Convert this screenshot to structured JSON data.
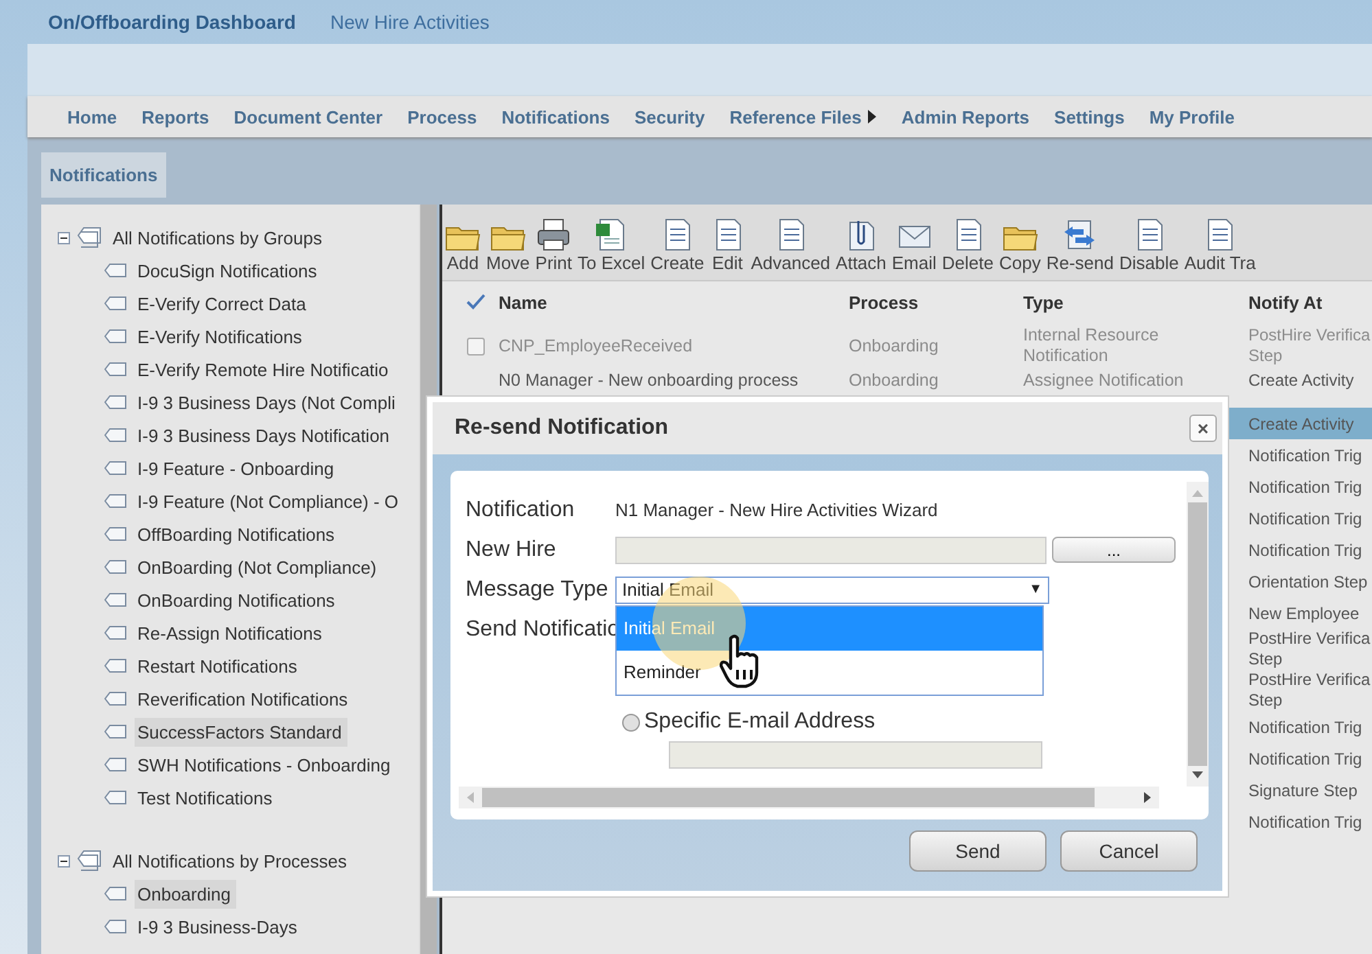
{
  "header": {
    "title": "On/Offboarding Dashboard",
    "link": "New Hire Activities"
  },
  "nav": [
    {
      "label": "Home",
      "has_submenu": false
    },
    {
      "label": "Reports",
      "has_submenu": false
    },
    {
      "label": "Document Center",
      "has_submenu": false
    },
    {
      "label": "Process",
      "has_submenu": false
    },
    {
      "label": "Notifications",
      "has_submenu": false
    },
    {
      "label": "Security",
      "has_submenu": false
    },
    {
      "label": "Reference Files",
      "has_submenu": true
    },
    {
      "label": "Admin Reports",
      "has_submenu": false
    },
    {
      "label": "Settings",
      "has_submenu": false
    },
    {
      "label": "My Profile",
      "has_submenu": false
    }
  ],
  "tabs": [
    {
      "label": "Notifications",
      "selected": true
    }
  ],
  "tree": [
    {
      "label": "All Notifications by Groups",
      "expanded": true,
      "children": [
        {
          "label": "DocuSign Notifications",
          "selected": false
        },
        {
          "label": "E-Verify Correct Data",
          "selected": false
        },
        {
          "label": "E-Verify Notifications",
          "selected": false
        },
        {
          "label": "E-Verify Remote Hire Notificatio",
          "selected": false
        },
        {
          "label": "I-9 3 Business Days (Not Compli",
          "selected": false
        },
        {
          "label": "I-9 3 Business Days Notification",
          "selected": false
        },
        {
          "label": "I-9 Feature - Onboarding",
          "selected": false
        },
        {
          "label": "I-9 Feature (Not Compliance) - O",
          "selected": false
        },
        {
          "label": "OffBoarding Notifications",
          "selected": false
        },
        {
          "label": "OnBoarding (Not Compliance)",
          "selected": false
        },
        {
          "label": "OnBoarding Notifications",
          "selected": false
        },
        {
          "label": "Re-Assign Notifications",
          "selected": false
        },
        {
          "label": "Restart Notifications",
          "selected": false
        },
        {
          "label": "Reverification Notifications",
          "selected": false
        },
        {
          "label": "SuccessFactors Standard",
          "selected": true
        },
        {
          "label": "SWH Notifications - Onboarding",
          "selected": false
        },
        {
          "label": "Test Notifications",
          "selected": false
        }
      ]
    },
    {
      "label": "All Notifications by Processes",
      "expanded": true,
      "children": [
        {
          "label": "Onboarding",
          "selected": true
        },
        {
          "label": "I-9 3 Business-Days",
          "selected": false
        }
      ]
    }
  ],
  "toolbar": [
    "Add",
    "Move",
    "Print",
    "To Excel",
    "Create",
    "Edit",
    "Advanced",
    "Attach",
    "Email",
    "Delete",
    "Copy",
    "Re-send",
    "Disable",
    "Audit Tra"
  ],
  "table": {
    "columns": [
      "Name",
      "Process",
      "Type",
      "Notify At"
    ],
    "rows": [
      {
        "name": "CNP_EmployeeReceived",
        "process": "Onboarding",
        "type": "Internal Resource Notification",
        "notify_at": "PostHire Verifica Step",
        "checked": false,
        "disabled": true,
        "selected": false
      },
      {
        "name": "N0 Manager - New onboarding process",
        "process": "Onboarding",
        "type": "Assignee Notification",
        "notify_at": "Create Activity",
        "disabled": false,
        "selected": false
      },
      {
        "notify_at": "Create Activity",
        "disabled": false,
        "selected": true
      },
      {
        "notify_at": "Notification Trig",
        "disabled": false,
        "selected": false
      },
      {
        "notify_at": "Notification Trig",
        "disabled": false,
        "selected": false
      },
      {
        "notify_at": "Notification Trig",
        "disabled": false,
        "selected": false
      },
      {
        "notify_at": "Notification Trig",
        "disabled": false,
        "selected": false
      },
      {
        "notify_at": "Orientation Step",
        "disabled": false,
        "selected": false
      },
      {
        "notify_at": "New Employee",
        "disabled": false,
        "selected": false
      },
      {
        "notify_at": "PostHire Verifica Step",
        "disabled": false,
        "selected": false
      },
      {
        "notify_at": "PostHire Verifica Step",
        "disabled": false,
        "selected": false
      },
      {
        "notify_at": "Notification Trig",
        "disabled": false,
        "selected": false
      },
      {
        "notify_at": "Notification Trig",
        "disabled": false,
        "selected": false
      },
      {
        "notify_at": "Signature Step",
        "disabled": false,
        "selected": false
      },
      {
        "notify_at": "Notification Trig",
        "disabled": false,
        "selected": false
      }
    ]
  },
  "dialog": {
    "title": "Re-send Notification",
    "close": "×",
    "notification_label": "Notification",
    "notification_value": "N1 Manager - New Hire Activities Wizard",
    "new_hire_label": "New Hire",
    "browse_button": "...",
    "message_type_label": "Message Type",
    "message_type": {
      "value": "Initial Email",
      "arrow": "▼",
      "expanded": true,
      "options": [
        {
          "label": "Initial Email",
          "selected": true
        },
        {
          "label": "Reminder",
          "selected": false
        }
      ]
    },
    "send_label": "Send Notificatio",
    "radio": {
      "label": "Specific E-mail Address",
      "selected": false
    },
    "buttons": [
      "Send",
      "Cancel"
    ]
  }
}
